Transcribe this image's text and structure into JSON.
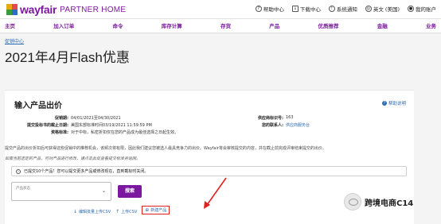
{
  "header": {
    "brand": "wayfair",
    "brand_sub": "PARTNER HOME",
    "links": [
      {
        "label": "帮助中心",
        "icon": "help-icon"
      },
      {
        "label": "下载中心",
        "icon": "download-icon"
      },
      {
        "label": "系统通知",
        "icon": "notification-icon"
      },
      {
        "label": "英文 (美国)",
        "icon": "globe-icon"
      },
      {
        "label": "我的账户",
        "icon": "user-icon"
      }
    ]
  },
  "nav": {
    "items": [
      "主页",
      "加入订单",
      "命令",
      "库存计算",
      "存货",
      "产品",
      "优质推荐",
      "金融",
      "业务"
    ]
  },
  "breadcrumb": "促销中心",
  "page_title": "2021年4月Flash优惠",
  "card": {
    "title": "输入产品出价",
    "help_label": "帮助说明",
    "fields": {
      "valid_period_label": "促销期:",
      "valid_period_value": "04/01/2021至04/30/2021",
      "submit_deadline_label": "提交投标书的截止日期:",
      "submit_deadline_value": "美国东部标准时间03/19/2021 11:59:59 PM",
      "criteria_label": "资格标准:",
      "criteria_value": "对于中标，私密折扣仅在您的产品成为最佳选择之日起生效。",
      "supplier_id_label": "供应商标识号:",
      "supplier_id_value": "163",
      "contact_label": "您的联系人:",
      "contact_value": "供应商服务台"
    },
    "paragraph_1": "提交产品的出价折扣后可获得这些促销中的推荐机会，该频次将有限，因此我们建议您被选人最具竞争力的出价。Wayfair将会审核提交的内容，并在截止前完成评审结束提交的出价。",
    "paragraph_2": "如需当前选定的产品，可对产品进行修改，请点击此处查看提交标准并返回。",
    "info_text": "已提交10个产品！您可以提交更多产品或修改现在，直到截标时关闭。",
    "status_select_label": "产品状态",
    "search_button": "搜索",
    "actions": [
      {
        "label": "编辑批量上传CSV",
        "icon": "download-icon"
      },
      {
        "label": "上传CSV",
        "icon": "upload-icon"
      },
      {
        "label": "新建产品",
        "icon": "plus-icon"
      }
    ],
    "accent_color": "#7b189f",
    "highlight_color": "#e02020"
  },
  "watermark": "跨境电商C14"
}
